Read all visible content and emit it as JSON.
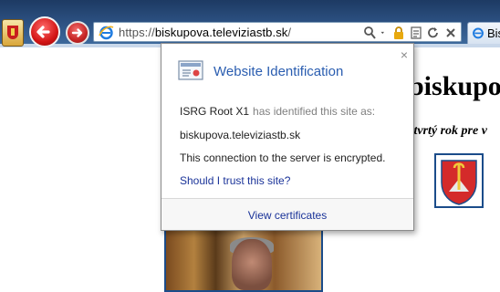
{
  "browser": {
    "address_bar": {
      "url_prefix": "https://",
      "url_host": "biskupova.televiziastb.sk",
      "url_suffix": "/"
    },
    "second_tab": {
      "label": "Bis"
    },
    "toolbar_icons": [
      "favorites-crest-icon",
      "back-arrow-icon",
      "forward-arrow-icon",
      "ie-logo-icon",
      "search-icon",
      "dropdown-icon",
      "lock-icon",
      "compatibility-icon",
      "refresh-icon",
      "stop-icon"
    ]
  },
  "page": {
    "heading": "biskupov",
    "subtitle": "štvrtý rok pre v"
  },
  "popup": {
    "title": "Website Identification",
    "issuer": "ISRG Root X1",
    "identified_text": "has identified this site as:",
    "site": "biskupova.televiziastb.sk",
    "encryption_text": "This connection to the server is encrypted.",
    "trust_link": "Should I trust this site?",
    "view_certificates": "View certificates",
    "close_glyph": "×"
  },
  "colors": {
    "link": "#1a3399",
    "title": "#2a5db0",
    "chrome": "#2b4f7f"
  }
}
